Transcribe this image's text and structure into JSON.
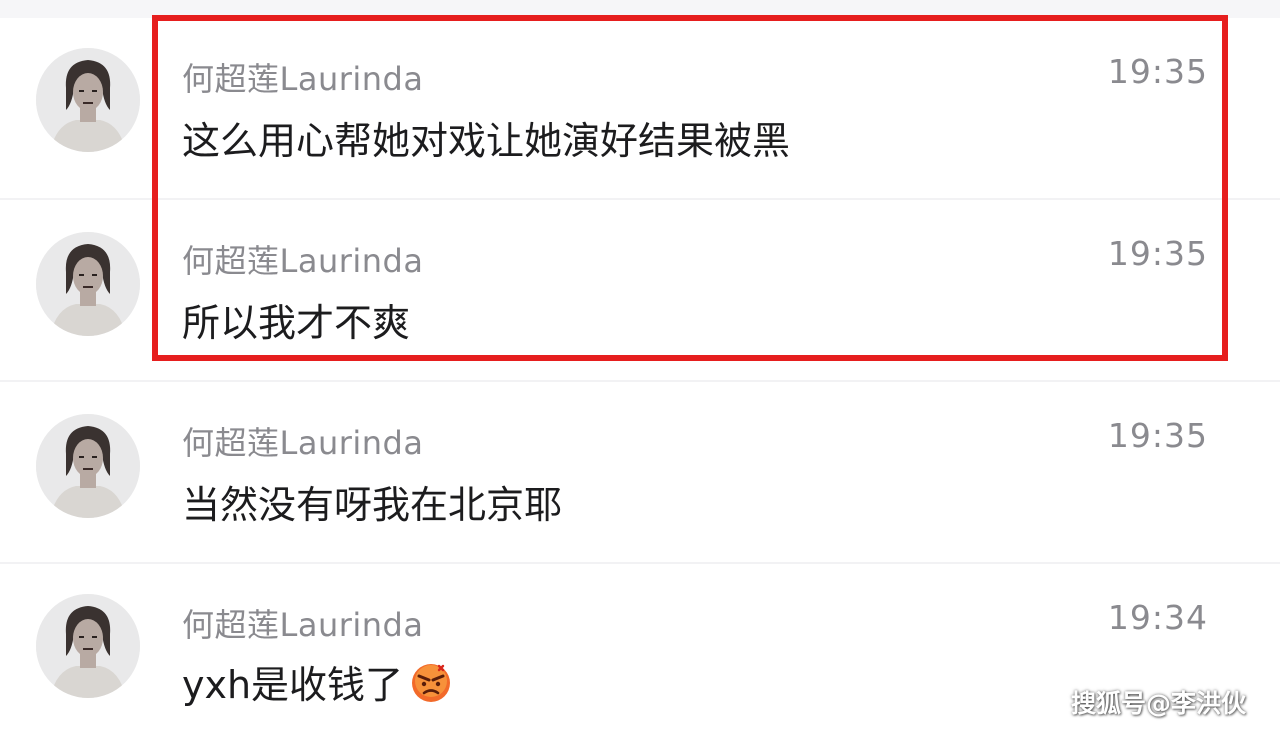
{
  "messages": [
    {
      "sender": "何超莲Laurinda",
      "time": "19:35",
      "text": "这么用心帮她对戏让她演好结果被黑",
      "highlighted": true
    },
    {
      "sender": "何超莲Laurinda",
      "time": "19:35",
      "text": "所以我才不爽",
      "highlighted": true
    },
    {
      "sender": "何超莲Laurinda",
      "time": "19:35",
      "text": "当然没有呀我在北京耶",
      "highlighted": false
    },
    {
      "sender": "何超莲Laurinda",
      "time": "19:34",
      "text": "yxh是收钱了",
      "emoji": "angry-face-emoji",
      "highlighted": false
    }
  ],
  "highlight": {
    "color": "#e61e1e"
  },
  "watermark": "搜狐号@李洪伙",
  "icons": {
    "avatar": "profile-photo",
    "emoji": "angry-face-emoji"
  }
}
